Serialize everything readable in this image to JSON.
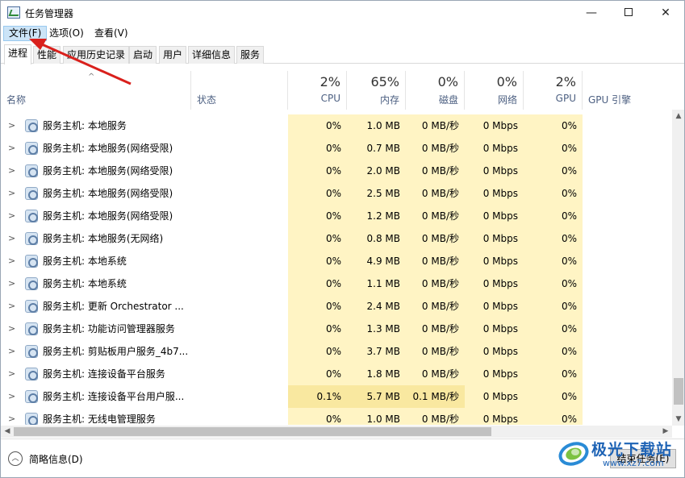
{
  "window": {
    "title": "任务管理器",
    "minimize": "—",
    "close": "✕"
  },
  "menu": [
    {
      "label": "文件(F)",
      "active": true
    },
    {
      "label": "选项(O)",
      "active": false
    },
    {
      "label": "查看(V)",
      "active": false
    }
  ],
  "tabs": [
    "进程",
    "性能",
    "应用历史记录",
    "启动",
    "用户",
    "详细信息",
    "服务"
  ],
  "columns": {
    "name": "名称",
    "status": "状态",
    "cpu": {
      "pct": "2%",
      "label": "CPU"
    },
    "mem": {
      "pct": "65%",
      "label": "内存"
    },
    "disk": {
      "pct": "0%",
      "label": "磁盘"
    },
    "net": {
      "pct": "0%",
      "label": "网络"
    },
    "gpu": {
      "pct": "2%",
      "label": "GPU"
    },
    "gpu_engine": "GPU 引擎"
  },
  "rows": [
    {
      "name": "服务主机: 本地服务",
      "cpu": "0%",
      "mem": "1.0 MB",
      "disk": "0 MB/秒",
      "net": "0 Mbps",
      "gpu": "0%"
    },
    {
      "name": "服务主机: 本地服务(网络受限)",
      "cpu": "0%",
      "mem": "0.7 MB",
      "disk": "0 MB/秒",
      "net": "0 Mbps",
      "gpu": "0%"
    },
    {
      "name": "服务主机: 本地服务(网络受限)",
      "cpu": "0%",
      "mem": "2.0 MB",
      "disk": "0 MB/秒",
      "net": "0 Mbps",
      "gpu": "0%"
    },
    {
      "name": "服务主机: 本地服务(网络受限)",
      "cpu": "0%",
      "mem": "2.5 MB",
      "disk": "0 MB/秒",
      "net": "0 Mbps",
      "gpu": "0%"
    },
    {
      "name": "服务主机: 本地服务(网络受限)",
      "cpu": "0%",
      "mem": "1.2 MB",
      "disk": "0 MB/秒",
      "net": "0 Mbps",
      "gpu": "0%"
    },
    {
      "name": "服务主机: 本地服务(无网络)",
      "cpu": "0%",
      "mem": "0.8 MB",
      "disk": "0 MB/秒",
      "net": "0 Mbps",
      "gpu": "0%"
    },
    {
      "name": "服务主机: 本地系统",
      "cpu": "0%",
      "mem": "4.9 MB",
      "disk": "0 MB/秒",
      "net": "0 Mbps",
      "gpu": "0%"
    },
    {
      "name": "服务主机: 本地系统",
      "cpu": "0%",
      "mem": "1.1 MB",
      "disk": "0 MB/秒",
      "net": "0 Mbps",
      "gpu": "0%"
    },
    {
      "name": "服务主机: 更新 Orchestrator ...",
      "cpu": "0%",
      "mem": "2.4 MB",
      "disk": "0 MB/秒",
      "net": "0 Mbps",
      "gpu": "0%"
    },
    {
      "name": "服务主机: 功能访问管理器服务",
      "cpu": "0%",
      "mem": "1.3 MB",
      "disk": "0 MB/秒",
      "net": "0 Mbps",
      "gpu": "0%"
    },
    {
      "name": "服务主机: 剪贴板用户服务_4b7...",
      "cpu": "0%",
      "mem": "3.7 MB",
      "disk": "0 MB/秒",
      "net": "0 Mbps",
      "gpu": "0%"
    },
    {
      "name": "服务主机: 连接设备平台服务",
      "cpu": "0%",
      "mem": "1.8 MB",
      "disk": "0 MB/秒",
      "net": "0 Mbps",
      "gpu": "0%"
    },
    {
      "name": "服务主机: 连接设备平台用户服...",
      "cpu": "0.1%",
      "mem": "5.7 MB",
      "disk": "0.1 MB/秒",
      "net": "0 Mbps",
      "gpu": "0%"
    },
    {
      "name": "服务主机: 无线电管理服务",
      "cpu": "0%",
      "mem": "1.0 MB",
      "disk": "0 MB/秒",
      "net": "0 Mbps",
      "gpu": "0%"
    }
  ],
  "footer": {
    "brief": "简略信息(D)",
    "end_task": "结束任务(E)"
  },
  "watermark": {
    "text": "极光下载站",
    "url": "www.xz7.com"
  },
  "colors": {
    "heat_light": "#fff4c4",
    "heat_hot": "#f9e8a0",
    "annotation": "#d9201c",
    "menu_active": "#cce4f7"
  }
}
